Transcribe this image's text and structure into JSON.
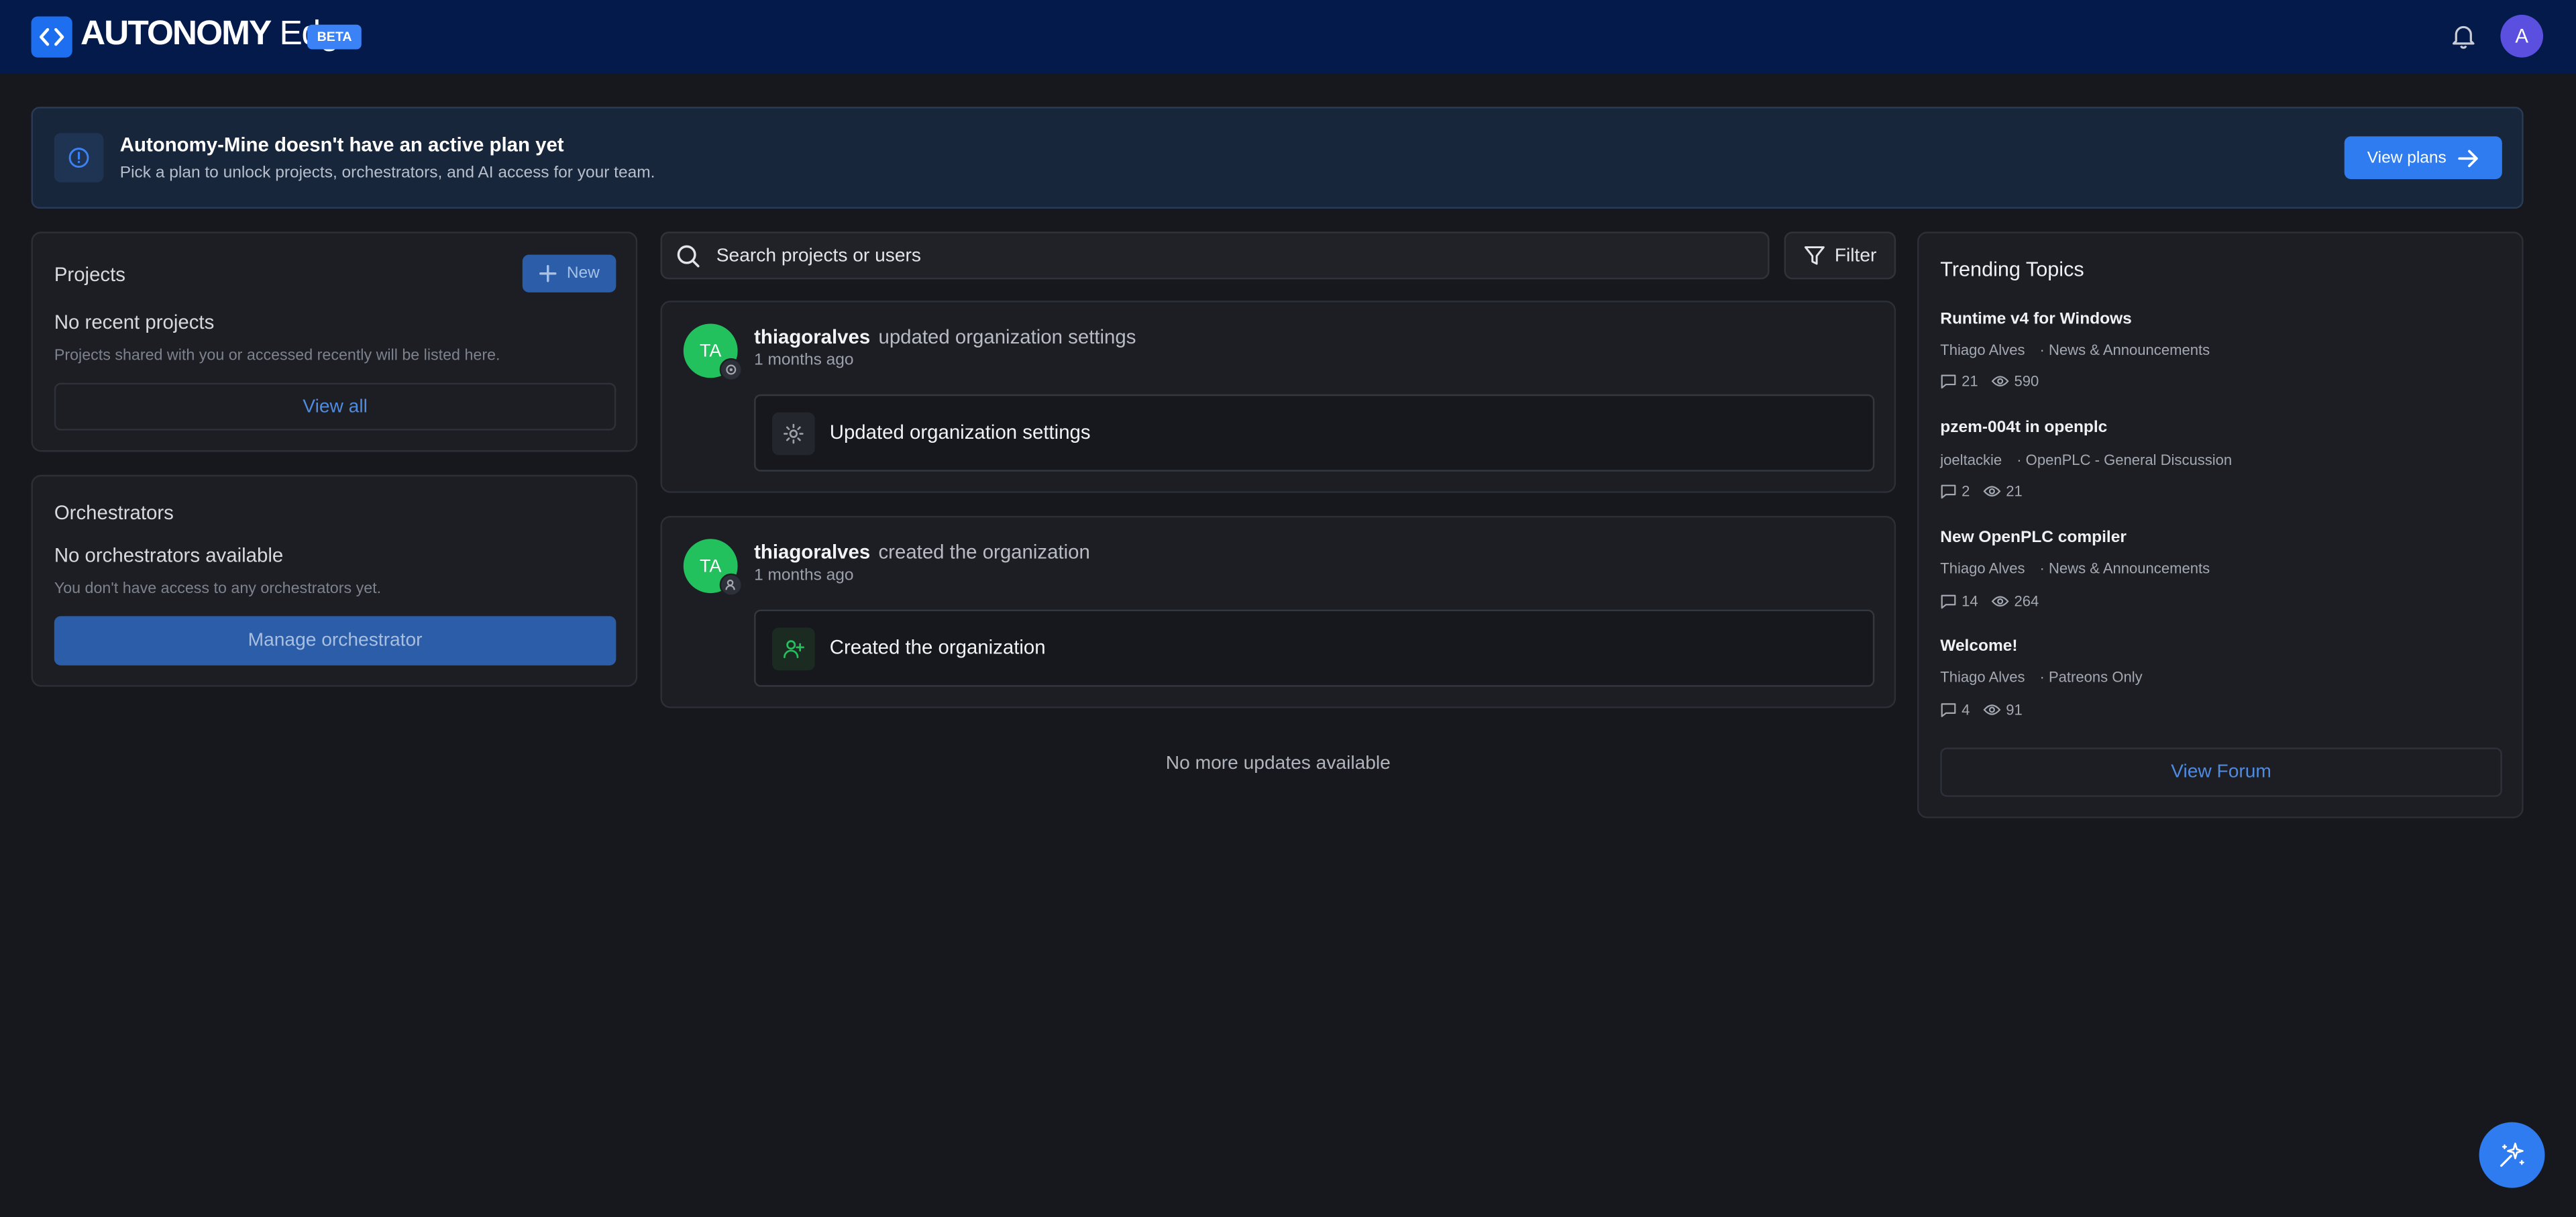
{
  "header": {
    "brand_strong": "AUTONOMY",
    "brand_light": "Edge",
    "badge": "BETA",
    "avatar_initial": "A"
  },
  "banner": {
    "title": "Autonomy-Mine doesn't have an active plan yet",
    "subtitle": "Pick a plan to unlock projects, orchestrators, and AI access for your team.",
    "button": "View plans"
  },
  "projects": {
    "title": "Projects",
    "new_button": "New",
    "empty_title": "No recent projects",
    "empty_sub": "Projects shared with you or accessed recently will be listed here.",
    "view_all": "View all"
  },
  "orchestrators": {
    "title": "Orchestrators",
    "empty_title": "No orchestrators available",
    "empty_sub": "You don't have access to any orchestrators yet.",
    "manage_button": "Manage orchestrator"
  },
  "search": {
    "placeholder": "Search projects or users",
    "filter_button": "Filter"
  },
  "feed": {
    "items": [
      {
        "initials": "TA",
        "user": "thiagoralves",
        "action": "updated organization settings",
        "time": "1 months ago",
        "detail": "Updated organization settings"
      },
      {
        "initials": "TA",
        "user": "thiagoralves",
        "action": "created the organization",
        "time": "1 months ago",
        "detail": "Created the organization"
      }
    ],
    "end_text": "No more updates available"
  },
  "trending": {
    "title": "Trending Topics",
    "topics": [
      {
        "title": "Runtime v4 for Windows",
        "author": "Thiago Alves",
        "category": "· News & Announcements",
        "comments": "21",
        "views": "590"
      },
      {
        "title": "pzem-004t in openplc",
        "author": "joeltackie",
        "category": "· OpenPLC - General Discussion",
        "comments": "2",
        "views": "21"
      },
      {
        "title": "New OpenPLC compiler",
        "author": "Thiago Alves",
        "category": "· News & Announcements",
        "comments": "14",
        "views": "264"
      },
      {
        "title": "Welcome!",
        "author": "Thiago Alves",
        "category": "· Patreons Only",
        "comments": "4",
        "views": "91"
      }
    ],
    "forum_button": "View Forum"
  },
  "colors": {
    "topbar": "#031a4b",
    "accent": "#2f7cf0",
    "avatar_green": "#22c15e",
    "background": "#17181d"
  }
}
